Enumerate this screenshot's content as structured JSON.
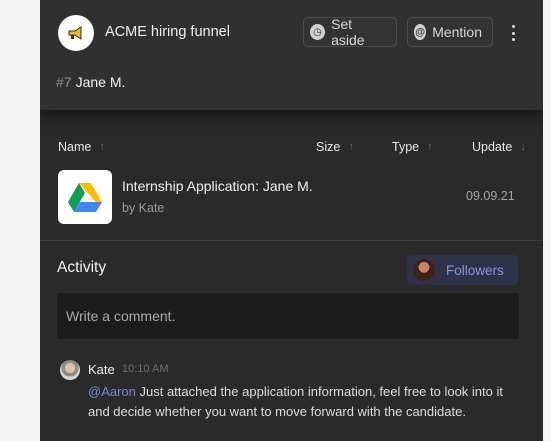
{
  "header": {
    "app_title": "ACME hiring funnel",
    "logo_icon": "megaphone-icon",
    "set_aside_label": "Set aside",
    "mention_label": "Mention",
    "ticket_number": "#7",
    "ticket_name": "Jane M."
  },
  "files": {
    "columns": {
      "name": "Name",
      "size": "Size",
      "type": "Type",
      "update": "Update"
    },
    "sort_up_arrow": "↑",
    "sort_down_arrow": "↓",
    "rows": [
      {
        "title": "Internship Application: Jane M.",
        "author": "by Kate",
        "date": "09.09.21",
        "icon": "google-drive-icon"
      }
    ]
  },
  "activity": {
    "title": "Activity",
    "followers_label": "Followers",
    "comment_placeholder": "Write a comment.",
    "comments": [
      {
        "author": "Kate",
        "time": "10:10 AM",
        "mention": "@Aaron",
        "text": " Just attached the application information, feel free to look into it and decide whether you want to move forward with the candidate."
      }
    ]
  },
  "colors": {
    "panel_bg": "#2a2a2a",
    "header_bg": "#303030",
    "accent": "#7b86d6",
    "followers_bg": "#2e3248"
  }
}
